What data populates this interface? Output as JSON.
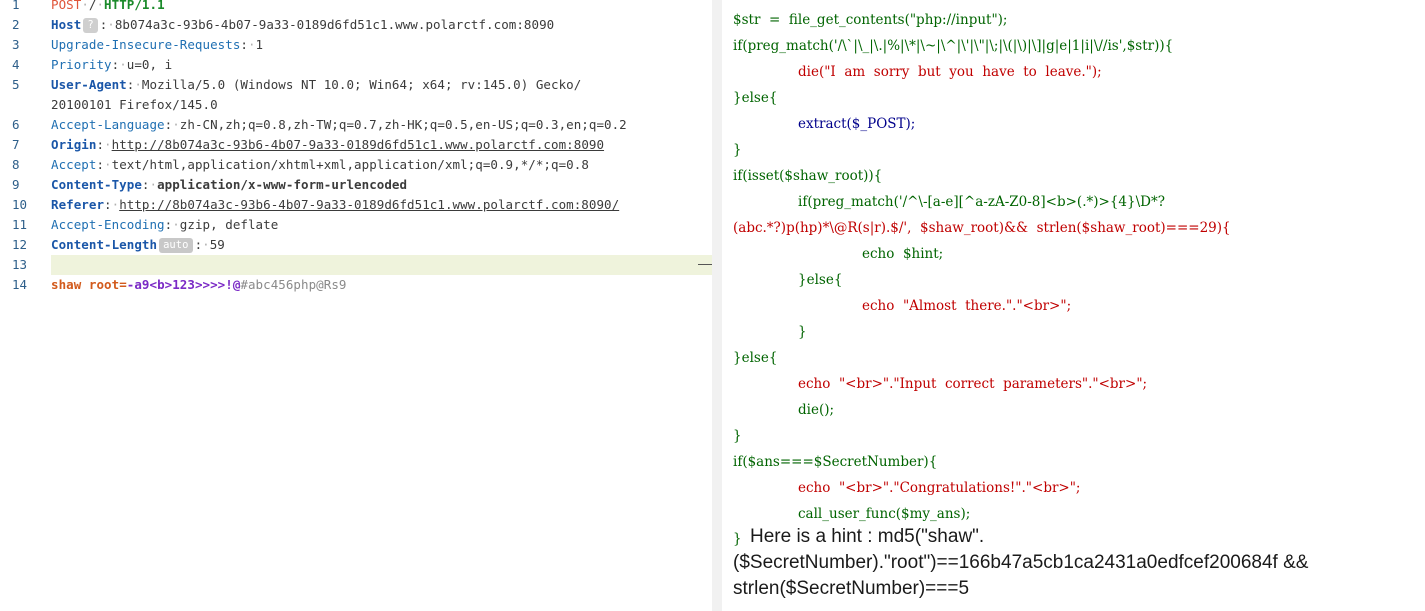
{
  "request": {
    "line_numbers": [
      "1",
      "2",
      "3",
      "4",
      "5",
      "",
      "6",
      "7",
      "8",
      "9",
      "10",
      "11",
      "12",
      "13",
      "14"
    ],
    "request_line": {
      "method": "POST",
      "path": "/",
      "protocol": "HTTP/1.1"
    },
    "headers": [
      {
        "name": "Host",
        "badge": "?",
        "value": "8b074a3c-93b6-4b07-9a33-0189d6fd51c1.www.polarctf.com:8090"
      },
      {
        "name": "Upgrade-Insecure-Requests",
        "value": "1"
      },
      {
        "name": "Priority",
        "value": "u=0, i"
      },
      {
        "name": "User-Agent",
        "value": "Mozilla/5.0 (Windows NT 10.0; Win64; x64; rv:145.0) Gecko/",
        "value_cont": "20100101 Firefox/145.0"
      },
      {
        "name": "Accept-Language",
        "value": "zh-CN,zh;q=0.8,zh-TW;q=0.7,zh-HK;q=0.5,en-US;q=0.3,en;q=0.2"
      },
      {
        "name": "Origin",
        "value": "http://8b074a3c-93b6-4b07-9a33-0189d6fd51c1.www.polarctf.com:8090"
      },
      {
        "name": "Accept",
        "value": "text/html,application/xhtml+xml,application/xml;q=0.9,*/*;q=0.8"
      },
      {
        "name": "Content-Type",
        "value": "application/x-www-form-urlencoded"
      },
      {
        "name": "Referer",
        "value": "http://8b074a3c-93b6-4b07-9a33-0189d6fd51c1.www.polarctf.com:8090/"
      },
      {
        "name": "Accept-Encoding",
        "value": "gzip, deflate"
      },
      {
        "name": "Content-Length",
        "badge": "auto",
        "value": "59"
      }
    ],
    "body": {
      "name": "shaw root",
      "eq": "=",
      "value": "-a9<b>123>>>>!@",
      "tail": "#abc456php@Rs9"
    }
  },
  "source": {
    "lines": [
      "$str  =  file_get_contents(\"php://input\");",
      "if(preg_match('/\\`|\\_|\\.|%|\\*|\\~|\\^|\\'|\\\"|\\;|\\(|\\)|\\]|g|e|1|i|\\//is',$str)){",
      "die(\"I  am  sorry  but  you  have  to  leave.\");",
      "}else{",
      "extract($_POST);",
      "}",
      "if(isset($shaw_root)){",
      "if(preg_match('/^\\-[a-e][^a-zA-Z0-8]<b>(.*)>{4}\\D*?",
      "(abc.*?)p(hp)*\\@R(s|r).$/',  $shaw_root)&&  strlen($shaw_root)===29){",
      "echo  $hint;",
      "}else{",
      "echo  \"Almost  there.\".\"<br>\";",
      "}",
      "}else{",
      "echo  \"<br>\".\"Input  correct  parameters\".\"<br>\";",
      "die();",
      "}",
      "if($ans===$SecretNumber){",
      "echo  \"<br>\".\"Congratulations!\".\"<br>\";",
      "call_user_func($my_ans);"
    ],
    "last_brace": "}",
    "hint_lines": [
      "Here is a hint : md5(\"shaw\".",
      "($SecretNumber).\"root\")==166b47a5cb1ca2431a0edfcef200684f &&",
      "strlen($SecretNumber)===5"
    ]
  }
}
